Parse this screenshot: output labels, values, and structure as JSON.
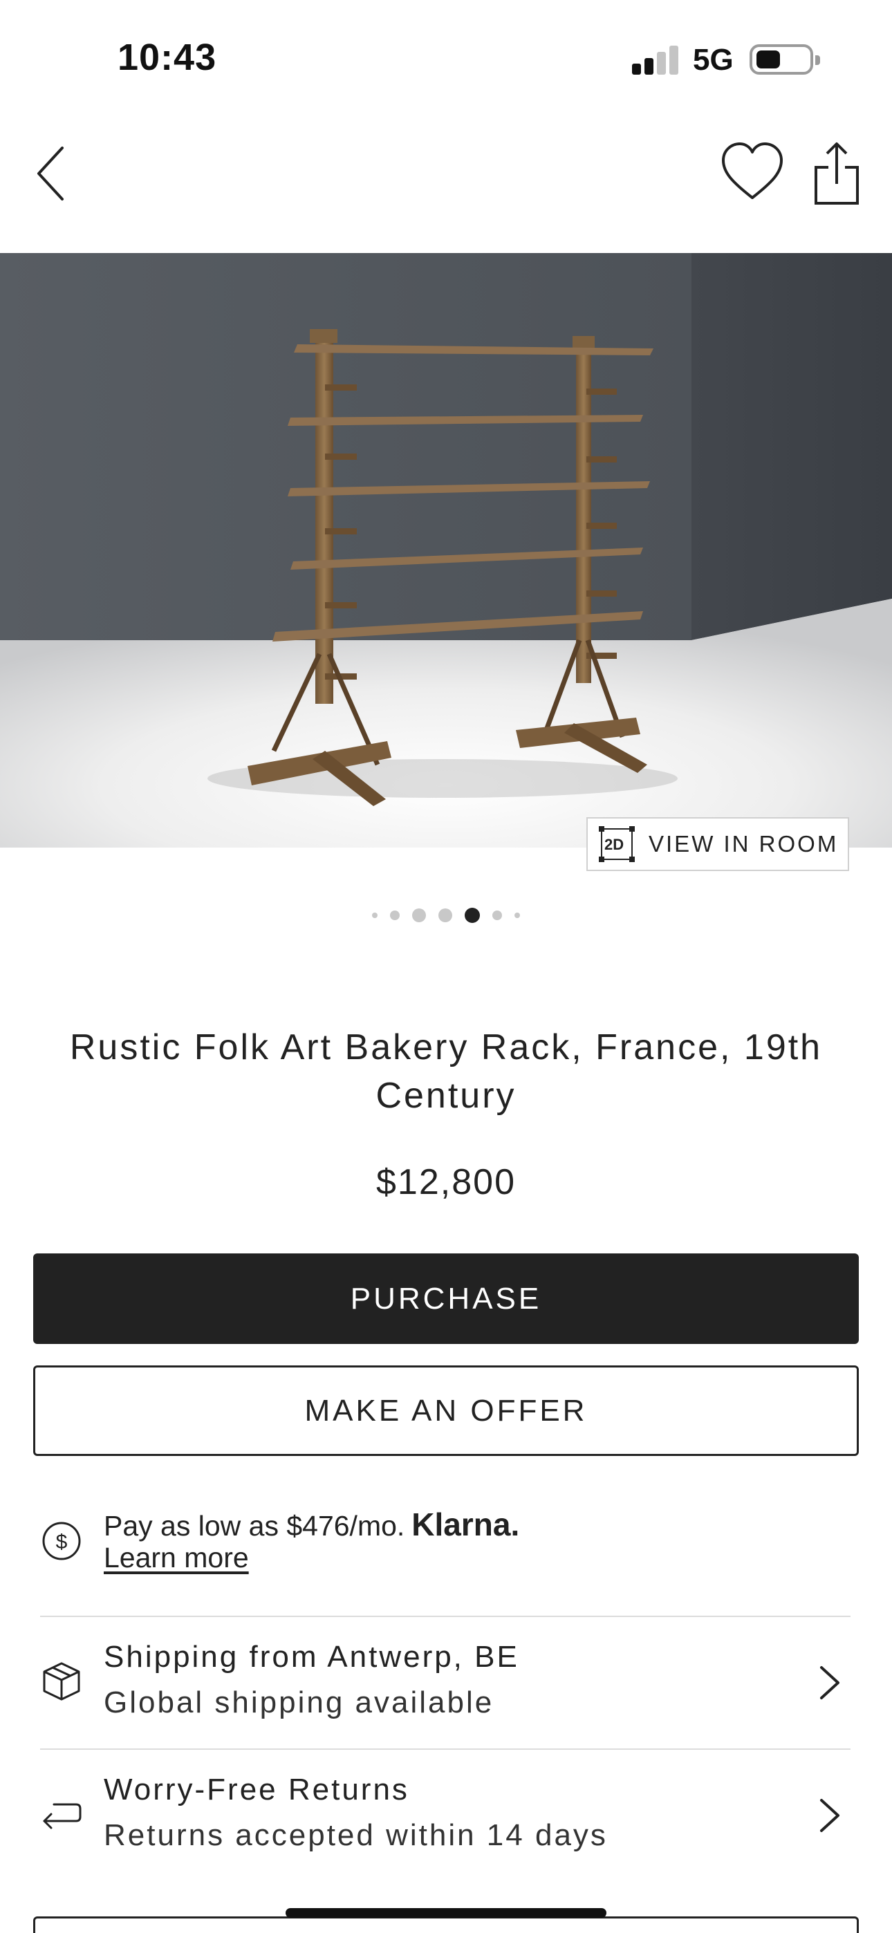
{
  "status_bar": {
    "time": "10:43",
    "network": "5G",
    "signal_bars_active": 2,
    "signal_bars_total": 4,
    "battery_level": 0.45
  },
  "nav": {
    "back_icon": "chevron-left-icon",
    "favorite_icon": "heart-icon",
    "share_icon": "share-icon"
  },
  "hero": {
    "view_in_room_badge": "2D",
    "view_in_room_label": "VIEW IN ROOM"
  },
  "carousel": {
    "dot_count": 7,
    "active_index": 4
  },
  "product": {
    "title": "Rustic Folk Art Bakery Rack, France, 19th Century",
    "price": "$12,800"
  },
  "actions": {
    "purchase_label": "PURCHASE",
    "offer_label": "MAKE AN OFFER"
  },
  "financing": {
    "text": "Pay as low as $476/mo.",
    "brand": "Klarna.",
    "learn_more": "Learn more",
    "icon": "dollar-circle-icon"
  },
  "info_rows": [
    {
      "icon": "box-icon",
      "primary": "Shipping from Antwerp, BE",
      "secondary": "Global shipping available"
    },
    {
      "icon": "return-arrow-icon",
      "primary": "Worry-Free Returns",
      "secondary": "Returns accepted within 14 days"
    }
  ],
  "colors": {
    "primary_button": "#222222",
    "background": "#ffffff",
    "wall": "#4a4f55",
    "wood": "#8a6a45"
  }
}
